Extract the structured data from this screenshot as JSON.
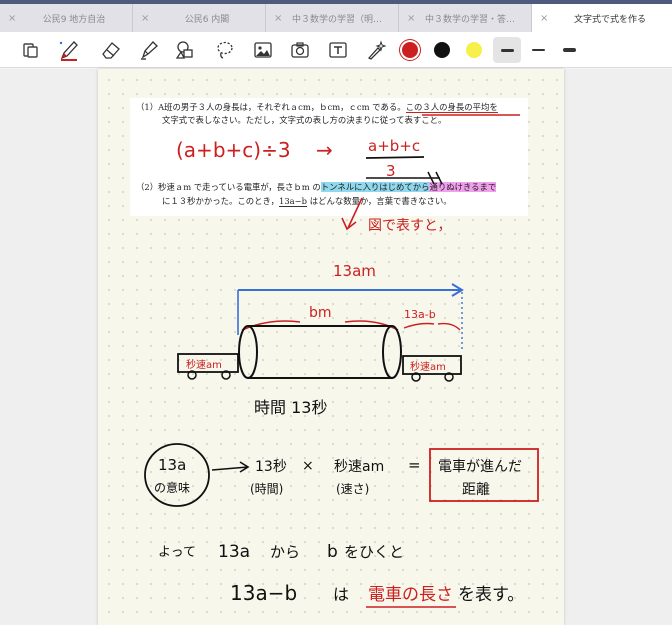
{
  "tabs": [
    {
      "label": "公民9 地方自治",
      "close": "×",
      "active": false
    },
    {
      "label": "公民6 内閣",
      "close": "×",
      "active": false
    },
    {
      "label": "中３数学の学習（明治図…",
      "close": "×",
      "active": false
    },
    {
      "label": "中３数学の学習・答（明…",
      "close": "×",
      "active": false
    },
    {
      "label": "文字式で式を作る",
      "close": "×",
      "active": true
    }
  ],
  "toolbar": {
    "tools": [
      "view-icon",
      "pen-icon",
      "eraser-icon",
      "highlighter-icon",
      "shapes-icon",
      "lasso-icon",
      "image-icon",
      "camera-icon",
      "text-icon",
      "laser-icon"
    ],
    "colors": [
      "#cc2020",
      "#111111",
      "#f7ef4a"
    ],
    "selected_color": "#cc2020",
    "weights": [
      "thick",
      "medium",
      "medium-thick"
    ]
  },
  "problem": {
    "q1_line1a": "（1）A班の男子３人の身長は，それぞれａcm，ｂcm，ｃcm である。",
    "q1_line1b": "この３人の身長の平均を",
    "q1_line2": "文字式で表しなさい。ただし，文字式の表し方の決まりに従って表すこと。",
    "q2_line1a": "（2）秒速ａm で走っている電車が，長さｂm の",
    "q2_line1b": "トンネルに入りはじめてから",
    "q2_line1c": "通りぬけきるまで",
    "q2_line1d": "に",
    "q2_line2a": "に１３秒かかった。このとき，",
    "q2_line2b": "13a−b",
    "q2_line2c": " はどんな数量か，言葉で書きなさい。"
  },
  "handwriting": {
    "answer1_lhs": "(a+b+c)÷3",
    "arrow": "→",
    "answer1_num": "a+b+c",
    "answer1_den": "3",
    "figure_note": "図で表すと，",
    "len_total": "13am",
    "len_tunnel": "bm",
    "len_diff": "13a-b",
    "train_left": "秒速am",
    "train_right": "秒速am",
    "time_label": "時間 13秒",
    "circle_line1": "13a",
    "circle_line2": "の意味",
    "eq_time": "13秒",
    "eq_time_sub": "(時間)",
    "eq_times": "×",
    "eq_speed": "秒速am",
    "eq_speed_sub": "(速さ)",
    "eq_equals": "=",
    "box_line1": "電車が進んだ",
    "box_line2": "距離",
    "conclusion1_a": "よって",
    "conclusion1_b": "13a",
    "conclusion1_c": "から",
    "conclusion1_d": "b",
    "conclusion1_e": "をひくと",
    "conclusion2_a": "13a−b",
    "conclusion2_b": "は",
    "conclusion2_c": "電車の長さ",
    "conclusion2_d": "を表す。"
  }
}
